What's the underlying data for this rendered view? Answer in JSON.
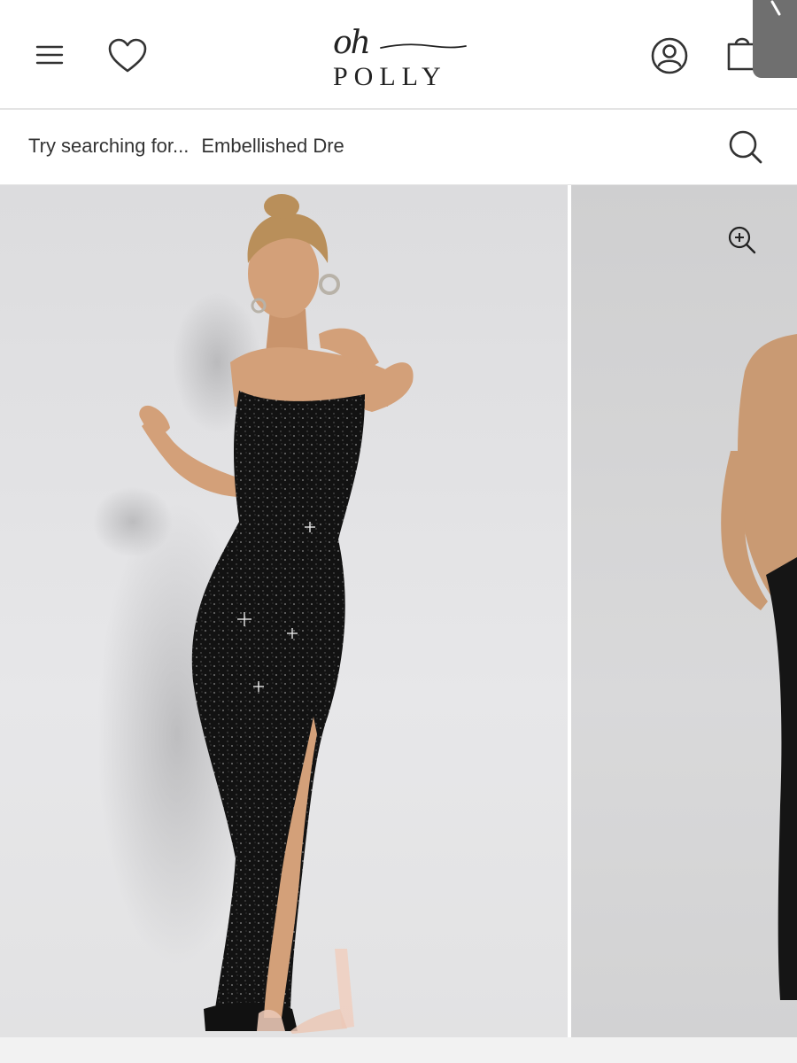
{
  "brand": {
    "logo_script": "oh",
    "logo_word": "POLLY"
  },
  "header": {
    "icons": [
      "menu-icon",
      "heart-icon",
      "account-icon",
      "bag-icon"
    ]
  },
  "search": {
    "prompt_label": "Try searching for...",
    "suggestion": "Embellished Dre"
  },
  "gallery": {
    "images": [
      {
        "subject": "model in black sequin strapless maxi dress",
        "active": true
      },
      {
        "subject": "partial next gallery image",
        "active": false
      }
    ],
    "zoom_icon": "zoom-in-icon"
  },
  "colors": {
    "dress": "#121212",
    "sequin": "#f3f3f3",
    "skin": "#d3a079",
    "hair": "#b98f5a",
    "backdrop": "#e3e3e5",
    "header_bg": "#ffffff"
  }
}
